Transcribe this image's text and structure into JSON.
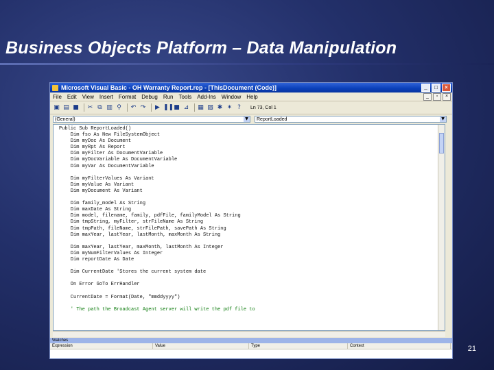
{
  "slide": {
    "title": "Business Objects Platform – Data Manipulation",
    "number": "21"
  },
  "vb_window": {
    "title": "Microsoft Visual Basic - OH Warranty Report.rep - [ThisDocument (Code)]",
    "menu": [
      "File",
      "Edit",
      "View",
      "Insert",
      "Format",
      "Debug",
      "Run",
      "Tools",
      "Add-Ins",
      "Window",
      "Help"
    ],
    "toolbar_position": "Ln 73, Col 1",
    "object_combo": "(General)",
    "procedure_combo": "ReportLoaded",
    "code": [
      "Public Sub ReportLoaded()",
      "    Dim fso As New FileSystemObject",
      "    Dim myDoc As Document",
      "    Dim myRpt As Report",
      "    Dim myFilter As DocumentVariable",
      "    Dim myDocVariable As DocumentVariable",
      "    Dim myVar As DocumentVariable",
      "",
      "    Dim myFilterValues As Variant",
      "    Dim myValue As Variant",
      "    Dim myDocument As Variant",
      "",
      "    Dim family_model As String",
      "    Dim maxDate As String",
      "    Dim model, filename, family, pdfFile, familyModel As String",
      "    Dim tmpString, myFilter, strFileName As String",
      "    Dim tmpPath, fileName, strFilePath, savePath As String",
      "    Dim maxYear, lastYear, lastMonth, maxMonth As String",
      "",
      "    Dim maxYear, lastYear, maxMonth, lastMonth As Integer",
      "    Dim myNumFilterValues As Integer",
      "    Dim reportDate As Date",
      "",
      "    Dim CurrentDate 'Stores the current system date",
      "",
      "    On Error GoTo ErrHandler",
      "",
      "    CurrentDate = Format(Date, \"mmddyyyy\")",
      "",
      "    ' The path the Broadcast Agent server will write the pdf file to"
    ],
    "watches": {
      "title": "Watches",
      "columns": [
        "Expression",
        "Value",
        "Type",
        "Context"
      ]
    }
  },
  "colors": {
    "background": "#23306a",
    "titlebar": "#0a3fb8",
    "comment": "#0a7a0a"
  }
}
